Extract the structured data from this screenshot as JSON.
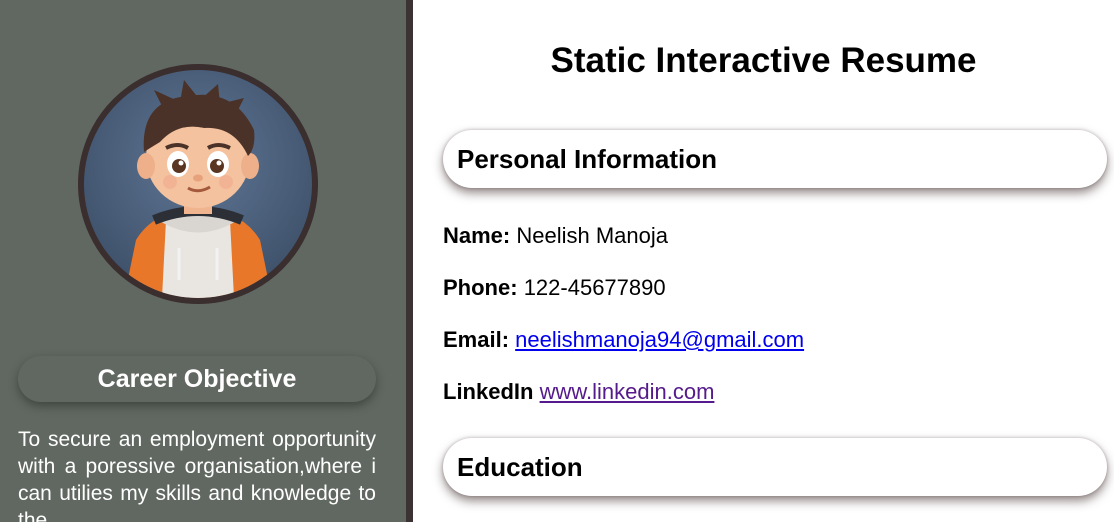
{
  "header": {
    "title": "Static Interactive Resume"
  },
  "sidebar": {
    "avatar_alt": "cartoon-boy-avatar",
    "objective_heading": "Career Objective",
    "objective_text": "To secure an employment opportunity with a poressive organisation,where i can utilies my skills and knowledge to the"
  },
  "personal": {
    "heading": "Personal Information",
    "name_label": "Name:",
    "name_value": "Neelish Manoja",
    "phone_label": "Phone:",
    "phone_value": "122-45677890",
    "email_label": "Email:",
    "email_value": "neelishmanoja94@gmail.com",
    "linkedin_label": "LinkedIn",
    "linkedin_value": "www.linkedin.com"
  },
  "education": {
    "heading": "Education"
  },
  "colors": {
    "sidebar_bg": "#616861",
    "divider": "#3b3333",
    "link": "#0000ee",
    "visited_link": "#551a8b"
  }
}
